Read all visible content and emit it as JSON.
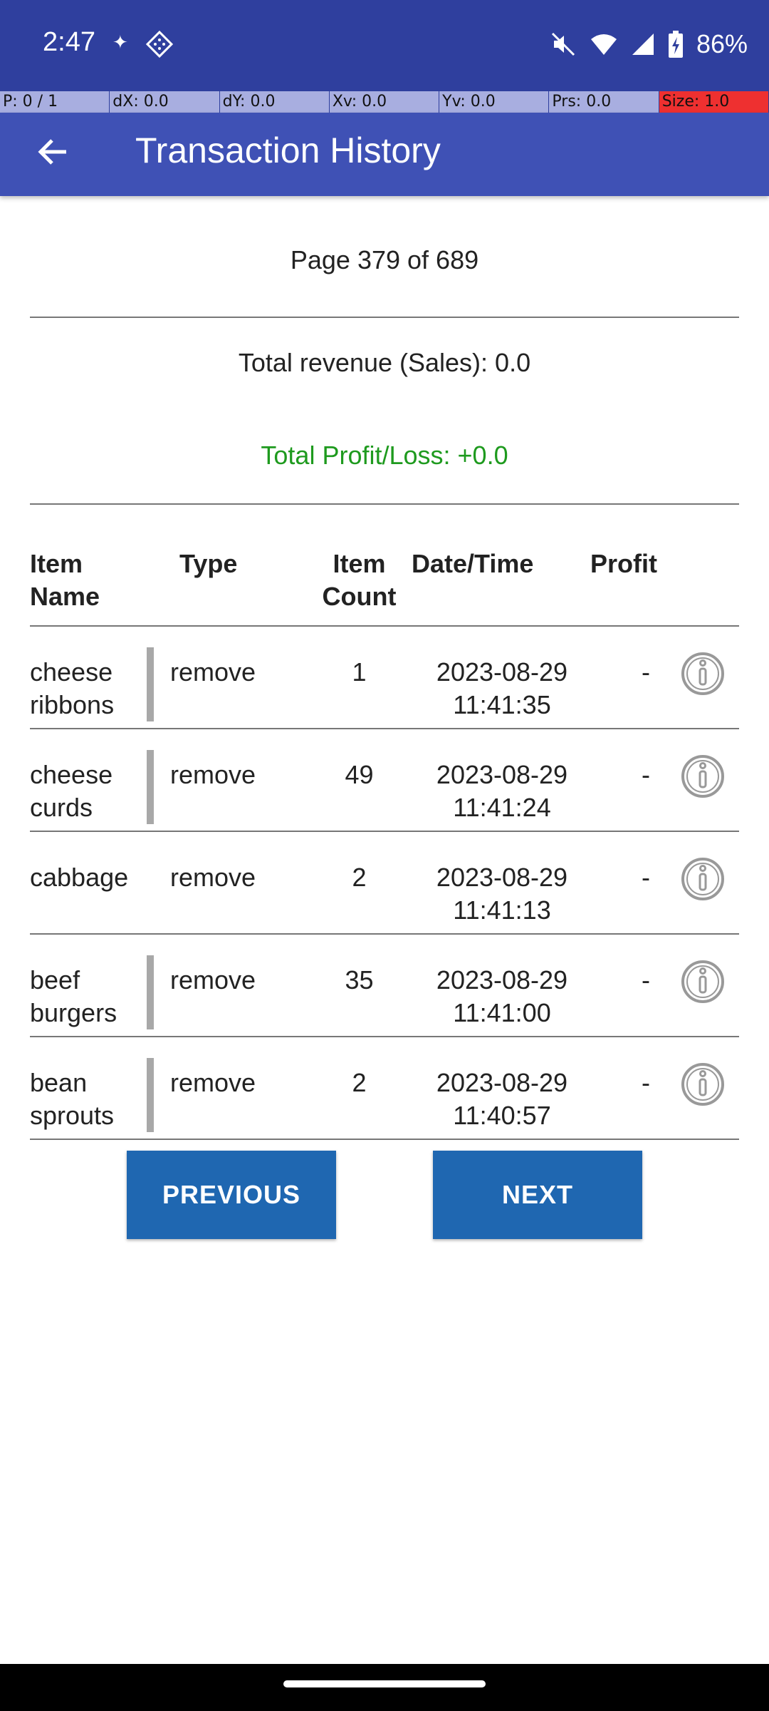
{
  "status_bar": {
    "time": "2:47",
    "battery": "86%"
  },
  "pointer_overlay": {
    "p": "P: 0 / 1",
    "dx": "dX: 0.0",
    "dy": "dY: 0.0",
    "xv": "Xv: 0.0",
    "yv": "Yv: 0.0",
    "prs": "Prs: 0.0",
    "size": "Size: 1.0"
  },
  "app_bar": {
    "title": "Transaction History"
  },
  "summary": {
    "page": "Page 379 of 689",
    "revenue": "Total revenue (Sales): 0.0",
    "profit": "Total Profit/Loss: +0.0",
    "profit_color": "#1e9a1e"
  },
  "table": {
    "headers": {
      "item_name": [
        "Item",
        "Name"
      ],
      "type": "Type",
      "item_count": [
        "Item",
        "Count"
      ],
      "datetime": "Date/Time",
      "profit": "Profit"
    },
    "rows": [
      {
        "name": [
          "cheese",
          "ribbons"
        ],
        "type": "remove",
        "count": "1",
        "date": "2023-08-29",
        "time": "11:41:35",
        "profit": "-"
      },
      {
        "name": [
          "cheese",
          "curds"
        ],
        "type": "remove",
        "count": "49",
        "date": "2023-08-29",
        "time": "11:41:24",
        "profit": "-"
      },
      {
        "name": [
          "cabbage",
          ""
        ],
        "type": "remove",
        "count": "2",
        "date": "2023-08-29",
        "time": "11:41:13",
        "profit": "-"
      },
      {
        "name": [
          "beef",
          "burgers"
        ],
        "type": "remove",
        "count": "35",
        "date": "2023-08-29",
        "time": "11:41:00",
        "profit": "-"
      },
      {
        "name": [
          "bean",
          "sprouts"
        ],
        "type": "remove",
        "count": "2",
        "date": "2023-08-29",
        "time": "11:40:57",
        "profit": "-"
      }
    ]
  },
  "buttons": {
    "previous": "PREVIOUS",
    "next": "NEXT"
  },
  "colors": {
    "status_bar": "#2f3f9e",
    "app_bar": "#3f51b5",
    "button": "#1f67b1"
  }
}
